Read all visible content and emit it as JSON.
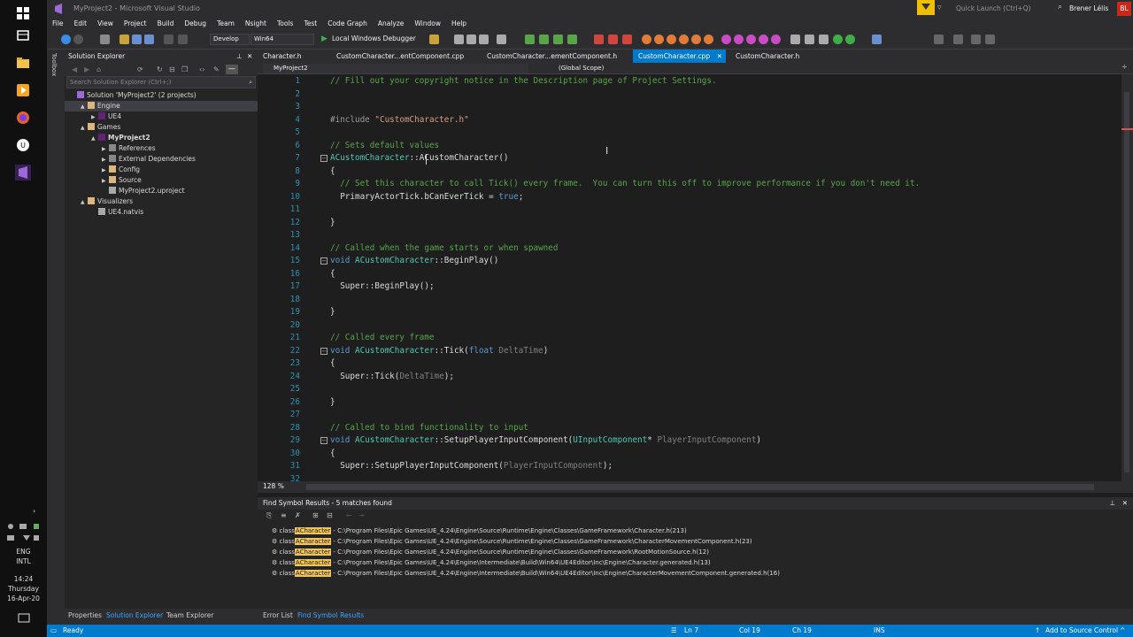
{
  "taskbar": {
    "lang": "ENG",
    "layout": "INTL",
    "time": "14:24",
    "day": "Thursday",
    "date": "16-Apr-20"
  },
  "title": "MyProject2 - Microsoft Visual Studio",
  "quick_launch": "Quick Launch (Ctrl+Q)",
  "user": {
    "name": "Brener Lélis",
    "initials": "BL"
  },
  "menu": [
    "File",
    "Edit",
    "View",
    "Project",
    "Build",
    "Debug",
    "Team",
    "Nsight",
    "Tools",
    "Test",
    "Code Graph",
    "Analyze",
    "Window",
    "Help"
  ],
  "toolbar": {
    "config": "Develop",
    "platform": "Win64",
    "run_label": "Local Windows Debugger"
  },
  "toolbox_label": "Toolbox",
  "solution_explorer": {
    "title": "Solution Explorer",
    "search_placeholder": "Search Solution Explorer (Ctrl+;)",
    "tree": [
      {
        "label": "Solution 'MyProject2' (2 projects)",
        "depth": 0,
        "expander": "",
        "icon": "solution-icon"
      },
      {
        "label": "Engine",
        "depth": 1,
        "expander": "▲",
        "icon": "folder-icon",
        "selected": true
      },
      {
        "label": "UE4",
        "depth": 2,
        "expander": "▶",
        "icon": "project-icon"
      },
      {
        "label": "Games",
        "depth": 1,
        "expander": "▲",
        "icon": "folder-icon"
      },
      {
        "label": "MyProject2",
        "depth": 2,
        "expander": "▲",
        "icon": "project-icon",
        "bold": true
      },
      {
        "label": "References",
        "depth": 3,
        "expander": "▶",
        "icon": "references-icon"
      },
      {
        "label": "External Dependencies",
        "depth": 3,
        "expander": "▶",
        "icon": "dependencies-icon"
      },
      {
        "label": "Config",
        "depth": 3,
        "expander": "▶",
        "icon": "folder-icon"
      },
      {
        "label": "Source",
        "depth": 3,
        "expander": "▶",
        "icon": "folder-icon"
      },
      {
        "label": "MyProject2.uproject",
        "depth": 3,
        "expander": "",
        "icon": "file-icon"
      },
      {
        "label": "Visualizers",
        "depth": 1,
        "expander": "▲",
        "icon": "folder-icon"
      },
      {
        "label": "UE4.natvis",
        "depth": 2,
        "expander": "",
        "icon": "file-icon"
      }
    ],
    "bottom_tabs": [
      "Properties",
      "Solution Explorer",
      "Team Explorer"
    ]
  },
  "doc_tabs": [
    {
      "label": "Character.h",
      "active": false
    },
    {
      "label": "CustomCharacter...entComponent.cpp",
      "active": false
    },
    {
      "label": "CustomCharacter...ementComponent.h",
      "active": false
    },
    {
      "label": "CustomCharacter.cpp",
      "active": true
    },
    {
      "label": "CustomCharacter.h",
      "active": false
    }
  ],
  "navbar": {
    "project": "MyProject2",
    "scope": "(Global Scope)"
  },
  "zoom": "128 %",
  "find_results": {
    "title": "Find Symbol Results - 5 matches found",
    "rows": [
      {
        "kind": "class",
        "match": "ACharacter",
        "path": " - C:\\Program Files\\Epic Games\\UE_4.24\\Engine\\Source\\Runtime\\Engine\\Classes\\GameFramework\\Character.h(213)"
      },
      {
        "kind": "class",
        "match": "ACharacter",
        "path": " - C:\\Program Files\\Epic Games\\UE_4.24\\Engine\\Source\\Runtime\\Engine\\Classes\\GameFramework\\CharacterMovementComponent.h(23)"
      },
      {
        "kind": "class",
        "match": "ACharacter",
        "path": " - C:\\Program Files\\Epic Games\\UE_4.24\\Engine\\Source\\Runtime\\Engine\\Classes\\GameFramework\\RootMotionSource.h(12)"
      },
      {
        "kind": "class",
        "match": "ACharacter",
        "path": " - C:\\Program Files\\Epic Games\\UE_4.24\\Engine\\Intermediate\\Build\\Win64\\UE4Editor\\Inc\\Engine\\Character.generated.h(13)"
      },
      {
        "kind": "class",
        "match": "ACharacter",
        "path": " - C:\\Program Files\\Epic Games\\UE_4.24\\Engine\\Intermediate\\Build\\Win64\\UE4Editor\\Inc\\Engine\\CharacterMovementComponent.generated.h(16)"
      }
    ],
    "tabs": [
      "Error List",
      "Find Symbol Results"
    ]
  },
  "status": {
    "ready": "Ready",
    "line": "Ln 7",
    "col": "Col 19",
    "ch": "Ch 19",
    "mode": "INS",
    "source_control": "Add to Source Control"
  },
  "code": [
    {
      "n": "1",
      "tokens": [
        [
          "cm",
          "// Fill out your copyright notice in the Description page of Project Settings."
        ]
      ]
    },
    {
      "n": "2",
      "tokens": []
    },
    {
      "n": "3",
      "tokens": []
    },
    {
      "n": "4",
      "tokens": [
        [
          "pp",
          "#include "
        ],
        [
          "str",
          "\"CustomCharacter.h\""
        ]
      ]
    },
    {
      "n": "5",
      "tokens": []
    },
    {
      "n": "6",
      "tokens": [
        [
          "cm",
          "// Sets default values"
        ]
      ]
    },
    {
      "n": "7",
      "fold": true,
      "tokens": [
        [
          "ty",
          "ACustomCharacter"
        ],
        [
          "",
          "::"
        ],
        [
          "",
          "ACustomCharacter"
        ],
        [
          "",
          "()"
        ]
      ]
    },
    {
      "n": "8",
      "tokens": [
        [
          "",
          "{"
        ]
      ]
    },
    {
      "n": "9",
      "tokens": [
        [
          "cm",
          "  // Set this character to call Tick() every frame.  You can turn this off to improve performance if you don't need it."
        ]
      ]
    },
    {
      "n": "10",
      "tokens": [
        [
          "",
          "  PrimaryActorTick.bCanEverTick = "
        ],
        [
          "kw",
          "true"
        ],
        [
          "",
          ";"
        ]
      ]
    },
    {
      "n": "11",
      "tokens": []
    },
    {
      "n": "12",
      "tokens": [
        [
          "",
          "}"
        ]
      ]
    },
    {
      "n": "13",
      "tokens": []
    },
    {
      "n": "14",
      "tokens": [
        [
          "cm",
          "// Called when the game starts or when spawned"
        ]
      ]
    },
    {
      "n": "15",
      "fold": true,
      "tokens": [
        [
          "kw",
          "void "
        ],
        [
          "ty",
          "ACustomCharacter"
        ],
        [
          "",
          "::BeginPlay()"
        ]
      ]
    },
    {
      "n": "16",
      "tokens": [
        [
          "",
          "{"
        ]
      ]
    },
    {
      "n": "17",
      "tokens": [
        [
          "",
          "  Super::BeginPlay();"
        ]
      ]
    },
    {
      "n": "18",
      "tokens": []
    },
    {
      "n": "19",
      "tokens": [
        [
          "",
          "}"
        ]
      ]
    },
    {
      "n": "20",
      "tokens": []
    },
    {
      "n": "21",
      "tokens": [
        [
          "cm",
          "// Called every frame"
        ]
      ]
    },
    {
      "n": "22",
      "fold": true,
      "tokens": [
        [
          "kw",
          "void "
        ],
        [
          "ty",
          "ACustomCharacter"
        ],
        [
          "",
          "::Tick("
        ],
        [
          "kw",
          "float "
        ],
        [
          "prm",
          "DeltaTime"
        ],
        [
          "",
          ")"
        ]
      ]
    },
    {
      "n": "23",
      "tokens": [
        [
          "",
          "{"
        ]
      ]
    },
    {
      "n": "24",
      "tokens": [
        [
          "",
          "  Super::Tick("
        ],
        [
          "prm",
          "DeltaTime"
        ],
        [
          "",
          ");"
        ]
      ]
    },
    {
      "n": "25",
      "tokens": []
    },
    {
      "n": "26",
      "tokens": [
        [
          "",
          "}"
        ]
      ]
    },
    {
      "n": "27",
      "tokens": []
    },
    {
      "n": "28",
      "tokens": [
        [
          "cm",
          "// Called to bind functionality to input"
        ]
      ]
    },
    {
      "n": "29",
      "fold": true,
      "tokens": [
        [
          "kw",
          "void "
        ],
        [
          "ty",
          "ACustomCharacter"
        ],
        [
          "",
          "::SetupPlayerInputComponent("
        ],
        [
          "ty",
          "UInputComponent"
        ],
        [
          "",
          "* "
        ],
        [
          "prm",
          "PlayerInputComponent"
        ],
        [
          "",
          ")"
        ]
      ]
    },
    {
      "n": "30",
      "tokens": [
        [
          "",
          "{"
        ]
      ]
    },
    {
      "n": "31",
      "tokens": [
        [
          "",
          "  Super::SetupPlayerInputComponent("
        ],
        [
          "prm",
          "PlayerInputComponent"
        ],
        [
          "",
          ");"
        ]
      ]
    },
    {
      "n": "32",
      "tokens": []
    }
  ]
}
